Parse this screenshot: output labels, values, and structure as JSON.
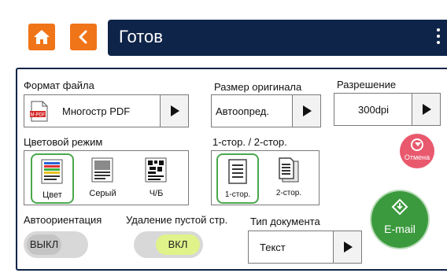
{
  "header": {
    "title": "Готов"
  },
  "file_format": {
    "label": "Формат файла",
    "value": "Многостр PDF",
    "icon_text": "M-PDF"
  },
  "original_size": {
    "label": "Размер оригинала",
    "value": "Автоопред."
  },
  "resolution": {
    "label": "Разрешение",
    "value": "300dpi"
  },
  "color_mode": {
    "label": "Цветовой режим",
    "options": [
      {
        "label": "Цвет",
        "selected": true
      },
      {
        "label": "Серый",
        "selected": false
      },
      {
        "label": "Ч/Б",
        "selected": false
      }
    ]
  },
  "duplex": {
    "label": "1-стор. / 2-стор.",
    "options": [
      {
        "label": "1-стор.",
        "selected": true
      },
      {
        "label": "2-стор.",
        "selected": false
      }
    ]
  },
  "cancel": {
    "label": "Отмена"
  },
  "auto_orientation": {
    "label": "Автоориентация",
    "state": "ВЫКЛ"
  },
  "blank_removal": {
    "label": "Удаление пустой стр.",
    "state": "ВКЛ"
  },
  "document_type": {
    "label": "Тип документа",
    "value": "Текст"
  },
  "email": {
    "label": "E-mail"
  },
  "colors": {
    "accent_orange": "#f07418",
    "header_navy": "#0e2448",
    "selected_green": "#4aa84c",
    "email_green": "#3c9a3e",
    "cancel_pink": "#e9596e",
    "toggle_on": "#dff38a"
  }
}
